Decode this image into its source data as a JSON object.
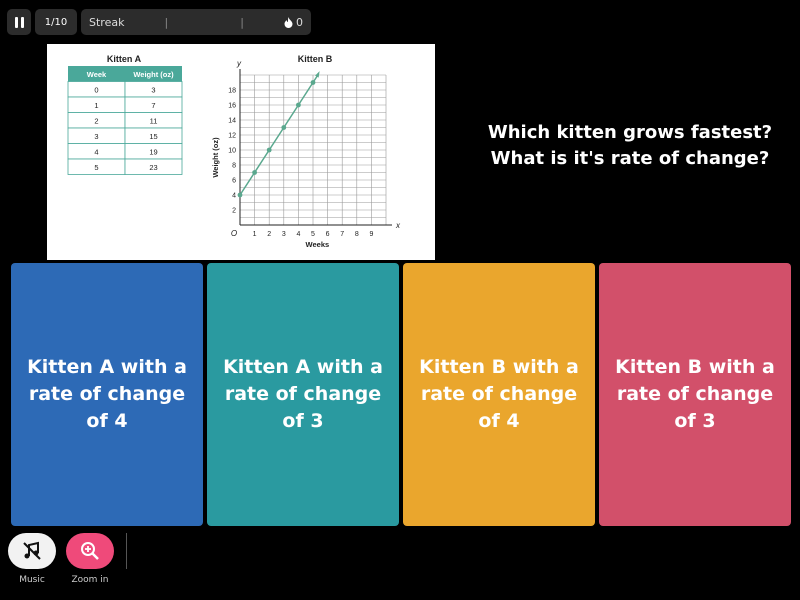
{
  "topbar": {
    "counter": "1/10",
    "streak_label": "Streak",
    "streak_count": "0"
  },
  "question": {
    "line1": "Which kitten grows fastest?",
    "line2": "What is it's rate of change?"
  },
  "table": {
    "title": "Kitten A",
    "headers": [
      "Week",
      "Weight (oz)"
    ],
    "rows": [
      [
        "0",
        "3"
      ],
      [
        "1",
        "7"
      ],
      [
        "2",
        "11"
      ],
      [
        "3",
        "15"
      ],
      [
        "4",
        "19"
      ],
      [
        "5",
        "23"
      ]
    ]
  },
  "chart_data": {
    "type": "line",
    "title": "Kitten B",
    "xlabel": "Weeks",
    "ylabel": "Weight (oz)",
    "x_axis_letter": "x",
    "y_axis_letter": "y",
    "origin_label": "O",
    "xlim": [
      0,
      10
    ],
    "ylim": [
      0,
      20
    ],
    "x_ticks": [
      1,
      2,
      3,
      4,
      5,
      6,
      7,
      8,
      9
    ],
    "y_ticks": [
      2,
      4,
      6,
      8,
      10,
      12,
      14,
      16,
      18
    ],
    "grid": true,
    "points": [
      {
        "x": 0,
        "y": 4
      },
      {
        "x": 1,
        "y": 7
      },
      {
        "x": 2,
        "y": 10
      },
      {
        "x": 3,
        "y": 13
      },
      {
        "x": 4,
        "y": 16
      },
      {
        "x": 5,
        "y": 19
      }
    ],
    "color": "#5aa88e"
  },
  "answers": [
    {
      "label": "Kitten A with a rate of change of 4",
      "color": "#2d6ab6"
    },
    {
      "label": "Kitten A with a rate of change of 3",
      "color": "#2a9aa0"
    },
    {
      "label": "Kitten B with a rate of change of 4",
      "color": "#eaa62d"
    },
    {
      "label": "Kitten B with a rate of change of 3",
      "color": "#d2506a"
    }
  ],
  "tools": [
    {
      "label": "Music"
    },
    {
      "label": "Zoom in"
    }
  ]
}
